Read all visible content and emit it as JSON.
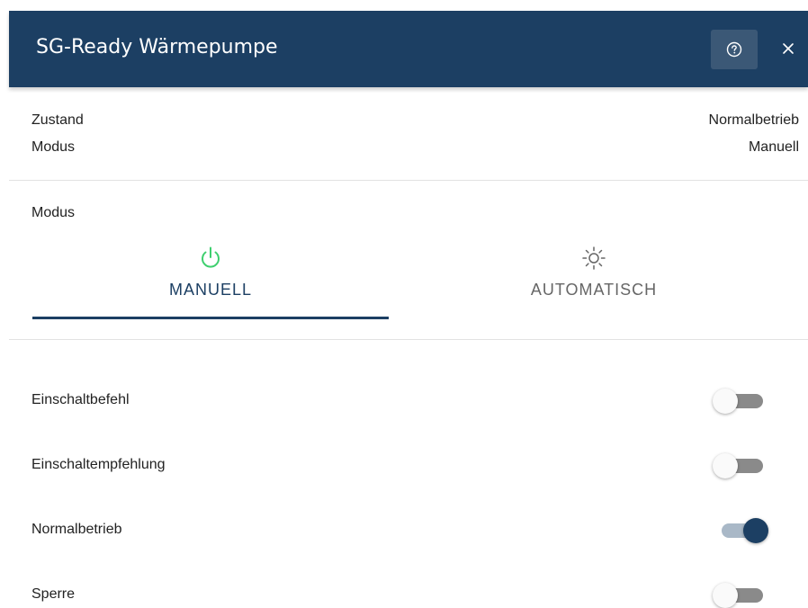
{
  "header": {
    "title": "SG-Ready Wärmepumpe",
    "help_icon": "help-circle-icon",
    "close_icon": "close-icon",
    "background": "#1c3f63"
  },
  "status": {
    "zustand_label": "Zustand",
    "zustand_value": "Normalbetrieb",
    "modus_label": "Modus",
    "modus_value": "Manuell"
  },
  "mode": {
    "section_label": "Modus",
    "tabs": [
      {
        "label": "MANUELL",
        "icon": "power-icon",
        "active": true,
        "icon_color": "#3ecf6e"
      },
      {
        "label": "AUTOMATISCH",
        "icon": "sun-icon",
        "active": false,
        "icon_color": "#666666"
      }
    ]
  },
  "toggles": [
    {
      "label": "Einschaltbefehl",
      "on": false
    },
    {
      "label": "Einschaltempfehlung",
      "on": false
    },
    {
      "label": "Normalbetrieb",
      "on": true
    },
    {
      "label": "Sperre",
      "on": false
    }
  ],
  "colors": {
    "accent": "#1c3f63",
    "toggle_on_track": "#a9b8c7",
    "toggle_off_track": "#8a8a8a",
    "power_icon": "#3ecf6e"
  }
}
